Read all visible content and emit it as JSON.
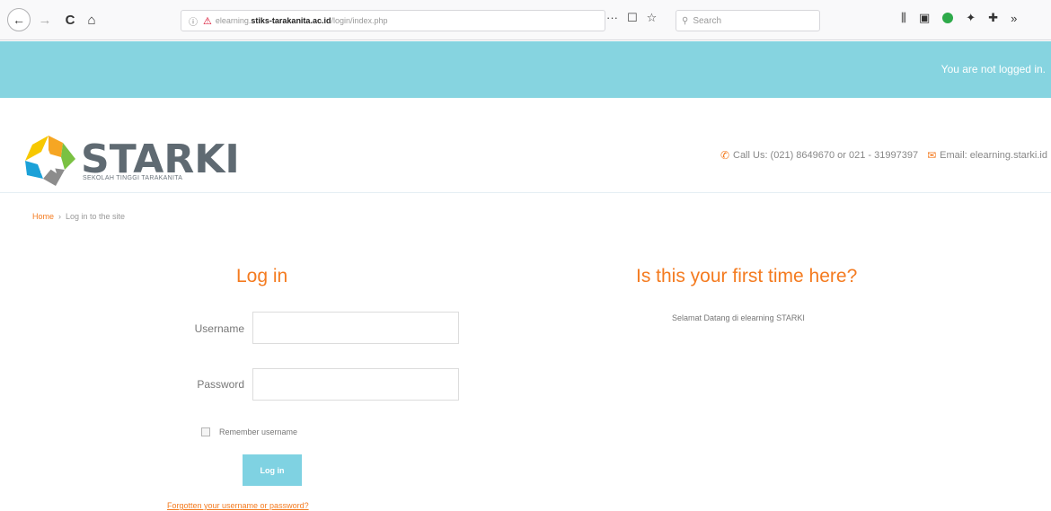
{
  "browser": {
    "url_prefix": "elearning.",
    "url_host": "stiks-tarakanita.ac.id",
    "url_path": "/login/index.php",
    "search_placeholder": "Search",
    "back_glyph": "←",
    "forward_glyph": "→",
    "reload_glyph": "C",
    "home_glyph": "⌂",
    "overflow_glyph": "»"
  },
  "topbar": {
    "status_text": "You are not logged in.",
    "color": "#86d4e0"
  },
  "header": {
    "logo_title": "STARKI",
    "logo_subtitle": "SEKOLAH TINGGI TARAKANITA",
    "call_text": "Call Us: (021) 8649670 or 021 - 31997397",
    "email_text": "Email: elearning.starki.id"
  },
  "breadcrumb": {
    "home": "Home",
    "separator": "›",
    "current": "Log in to the site"
  },
  "login": {
    "title": "Log in",
    "username_label": "Username",
    "password_label": "Password",
    "remember_label": "Remember username",
    "submit_label": "Log in",
    "forgot_link": "Forgotten your username or password?"
  },
  "first_time": {
    "title": "Is this your first time here?",
    "welcome_text": "Selamat Datang di elearning STARKI"
  },
  "colors": {
    "accent": "#f47b20",
    "teal": "#86d4e0",
    "button": "#7fd2e2"
  }
}
